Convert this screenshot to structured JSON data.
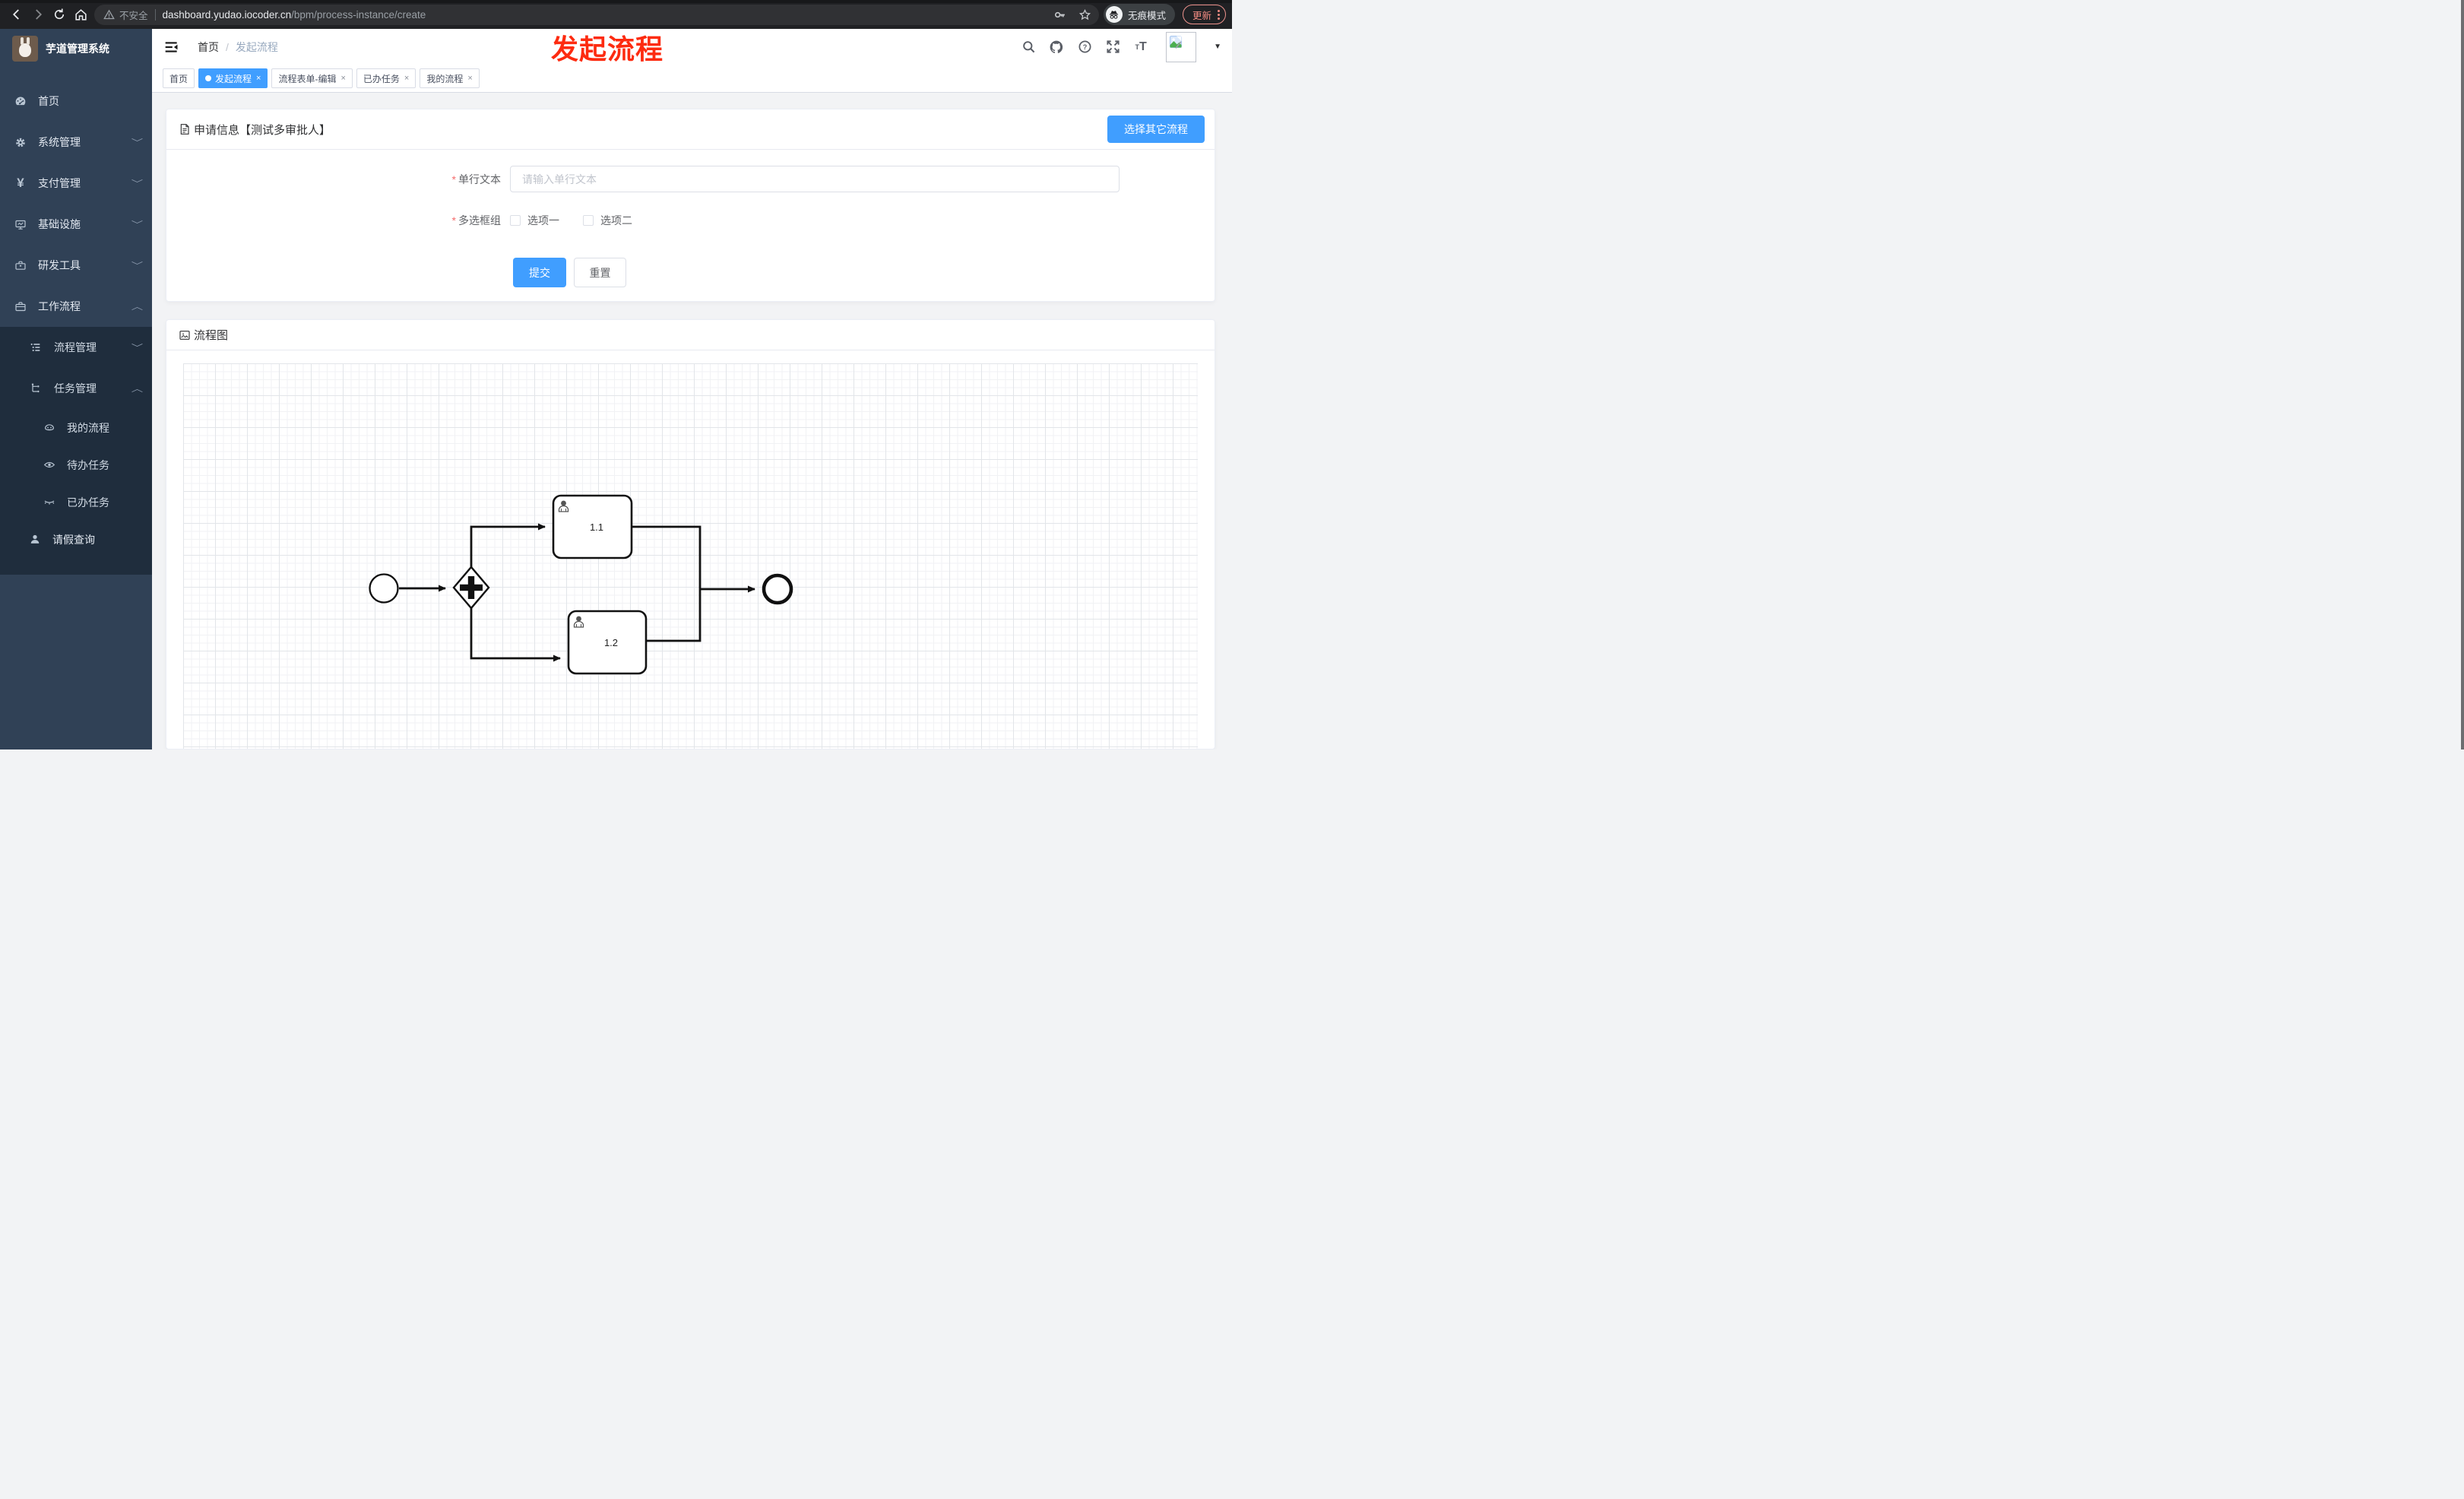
{
  "browser": {
    "security_label": "不安全",
    "url_host": "dashboard.yudao.iocoder.cn",
    "url_path": "/bpm/process-instance/create",
    "incognito_label": "无痕模式",
    "update_label": "更新"
  },
  "annotation": {
    "text": "发起流程",
    "color": "#fd2b10"
  },
  "sidebar": {
    "title": "芋道管理系统",
    "items": [
      {
        "label": "首页",
        "icon": "dashboard-icon",
        "expandable": false
      },
      {
        "label": "系统管理",
        "icon": "gear-icon",
        "expandable": true,
        "expanded": false
      },
      {
        "label": "支付管理",
        "icon": "yen-icon",
        "expandable": true,
        "expanded": false
      },
      {
        "label": "基础设施",
        "icon": "monitor-icon",
        "expandable": true,
        "expanded": false
      },
      {
        "label": "研发工具",
        "icon": "toolbox-icon",
        "expandable": true,
        "expanded": false
      },
      {
        "label": "工作流程",
        "icon": "briefcase-icon",
        "expandable": true,
        "expanded": true
      }
    ],
    "workflow_children": [
      {
        "label": "流程管理",
        "icon": "list-tree-icon",
        "expandable": true,
        "expanded": false
      },
      {
        "label": "任务管理",
        "icon": "share-tree-icon",
        "expandable": true,
        "expanded": true
      }
    ],
    "task_children": [
      {
        "label": "我的流程",
        "icon": "robot-icon"
      },
      {
        "label": "待办任务",
        "icon": "eye-icon"
      },
      {
        "label": "已办任务",
        "icon": "eye-closed-icon"
      }
    ],
    "leave_query": {
      "label": "请假查询",
      "icon": "user-icon"
    }
  },
  "header": {
    "breadcrumb": {
      "home": "首页",
      "separator": "/",
      "current": "发起流程"
    },
    "icons": [
      "search-icon",
      "github-icon",
      "help-icon",
      "fullscreen-icon",
      "font-size-icon",
      "avatar",
      "caret-down-icon"
    ]
  },
  "tabs": [
    {
      "label": "首页",
      "active": false,
      "closable": false
    },
    {
      "label": "发起流程",
      "active": true,
      "closable": true
    },
    {
      "label": "流程表单-编辑",
      "active": false,
      "closable": true
    },
    {
      "label": "已办任务",
      "active": false,
      "closable": true
    },
    {
      "label": "我的流程",
      "active": false,
      "closable": true
    }
  ],
  "form_card": {
    "title": "申请信息【测试多审批人】",
    "switch_button_label": "选择其它流程",
    "fields": {
      "text": {
        "label": "单行文本",
        "required": true,
        "placeholder": "请输入单行文本",
        "value": ""
      },
      "checkbox_group": {
        "label": "多选框组",
        "required": true,
        "options": [
          {
            "label": "选项一",
            "checked": false
          },
          {
            "label": "选项二",
            "checked": false
          }
        ]
      }
    },
    "submit_label": "提交",
    "reset_label": "重置"
  },
  "flow_card": {
    "title": "流程图",
    "bpmn": {
      "type": "diagram",
      "elements": [
        "start-event",
        "parallel-gateway",
        "user-task-1.1",
        "user-task-1.2",
        "end-event"
      ],
      "tasks": [
        {
          "label": "1.1"
        },
        {
          "label": "1.2"
        }
      ]
    }
  },
  "colors": {
    "primary": "#409eff",
    "sidebar_bg": "#304156",
    "submenu_bg": "#1f2d3d",
    "annotation_red": "#fd2b10"
  }
}
